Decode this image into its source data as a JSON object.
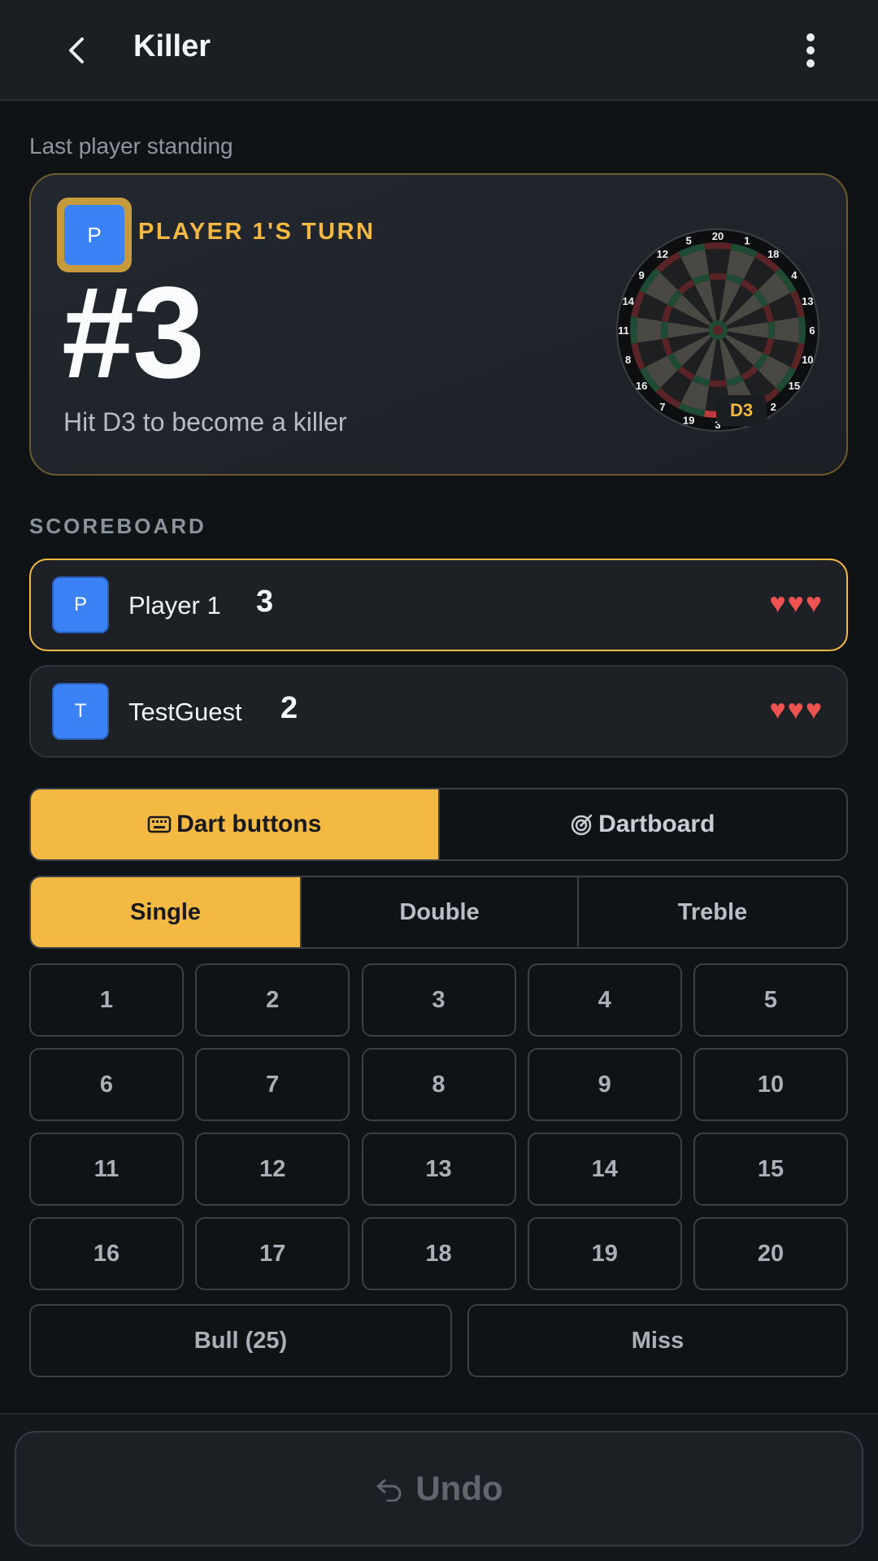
{
  "header": {
    "title": "Killer",
    "back_icon": "chevron-left-icon",
    "menu_icon": "more-vertical-icon"
  },
  "subtitle": "Last player standing",
  "turn_card": {
    "avatar_initial": "P",
    "turn_label": "PLAYER 1'S TURN",
    "target_number": "#3",
    "hint": "Hit D3 to become a killer",
    "board_tag": "D3",
    "board_numbers": [
      "20",
      "1",
      "18",
      "4",
      "13",
      "6",
      "10",
      "15",
      "2",
      "17",
      "3",
      "19",
      "7",
      "16",
      "8",
      "11",
      "14",
      "9",
      "12",
      "5"
    ],
    "colors": {
      "accent": "#f3b942",
      "border": "#6e5a2a"
    }
  },
  "scoreboard": {
    "label": "SCOREBOARD",
    "players": [
      {
        "initial": "P",
        "name": "Player 1",
        "score": "3",
        "lives": "♥♥♥",
        "active": true
      },
      {
        "initial": "T",
        "name": "TestGuest",
        "score": "2",
        "lives": "♥♥♥",
        "active": false
      }
    ]
  },
  "input_mode": {
    "options": [
      {
        "label": "Dart buttons",
        "icon": "keyboard-icon",
        "selected": true
      },
      {
        "label": "Dartboard",
        "icon": "target-icon",
        "selected": false
      }
    ]
  },
  "multiplier": {
    "options": [
      {
        "label": "Single",
        "selected": true
      },
      {
        "label": "Double",
        "selected": false
      },
      {
        "label": "Treble",
        "selected": false
      }
    ]
  },
  "numbers": [
    "1",
    "2",
    "3",
    "4",
    "5",
    "6",
    "7",
    "8",
    "9",
    "10",
    "11",
    "12",
    "13",
    "14",
    "15",
    "16",
    "17",
    "18",
    "19",
    "20"
  ],
  "bull_label": "Bull (25)",
  "miss_label": "Miss",
  "undo": {
    "label": "Undo",
    "icon": "undo-icon"
  },
  "colors": {
    "accent": "#f3b942",
    "background": "#101316",
    "heart": "#ef5350",
    "avatar": "#3b82f6"
  }
}
